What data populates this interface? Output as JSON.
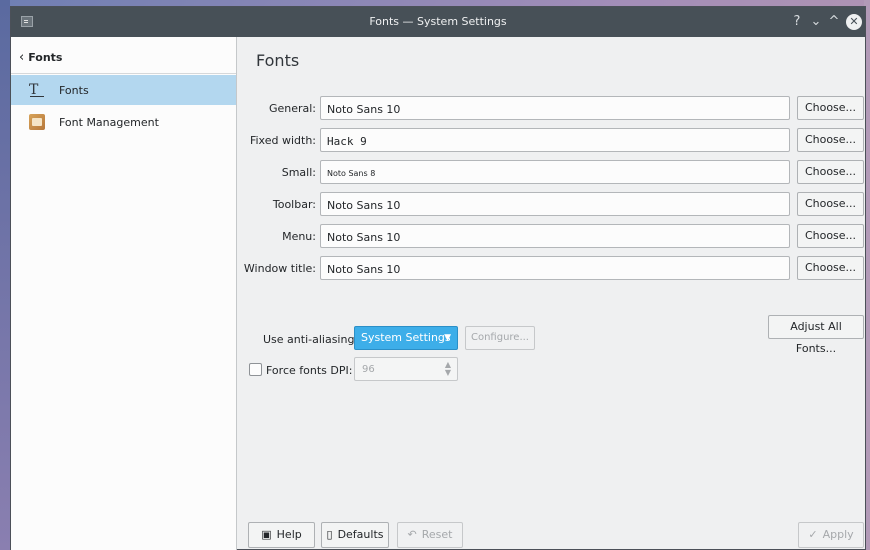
{
  "window": {
    "title": "Fonts — System Settings",
    "buttons": {
      "help": "?",
      "minimize": "⌄",
      "maximize": "^",
      "close": "✕"
    }
  },
  "sidebar": {
    "back_label": "Fonts",
    "items": [
      {
        "label": "Fonts",
        "icon": "font-icon",
        "selected": true
      },
      {
        "label": "Font Management",
        "icon": "font-management-icon",
        "selected": false
      }
    ]
  },
  "main": {
    "title": "Fonts",
    "font_rows": [
      {
        "label": "General:",
        "value": "Noto Sans 10",
        "button": "Choose..."
      },
      {
        "label": "Fixed width:",
        "value": "Hack  9",
        "button": "Choose..."
      },
      {
        "label": "Small:",
        "value": "Noto Sans 8",
        "button": "Choose..."
      },
      {
        "label": "Toolbar:",
        "value": "Noto Sans 10",
        "button": "Choose..."
      },
      {
        "label": "Menu:",
        "value": "Noto Sans 10",
        "button": "Choose..."
      },
      {
        "label": "Window title:",
        "value": "Noto Sans 10",
        "button": "Choose..."
      }
    ],
    "adjust_all": "Adjust All Fonts...",
    "anti_aliasing": {
      "label": "Use anti-aliasing:",
      "value": "System Settings",
      "configure": "Configure..."
    },
    "dpi": {
      "label": "Force fonts DPI:",
      "checked": false,
      "value": "96"
    }
  },
  "footer": {
    "help": "Help",
    "defaults": "Defaults",
    "reset": "Reset",
    "apply": "Apply"
  },
  "colors": {
    "accent": "#3daee9",
    "selection": "#b3d7ef",
    "titlebar": "#475057"
  }
}
